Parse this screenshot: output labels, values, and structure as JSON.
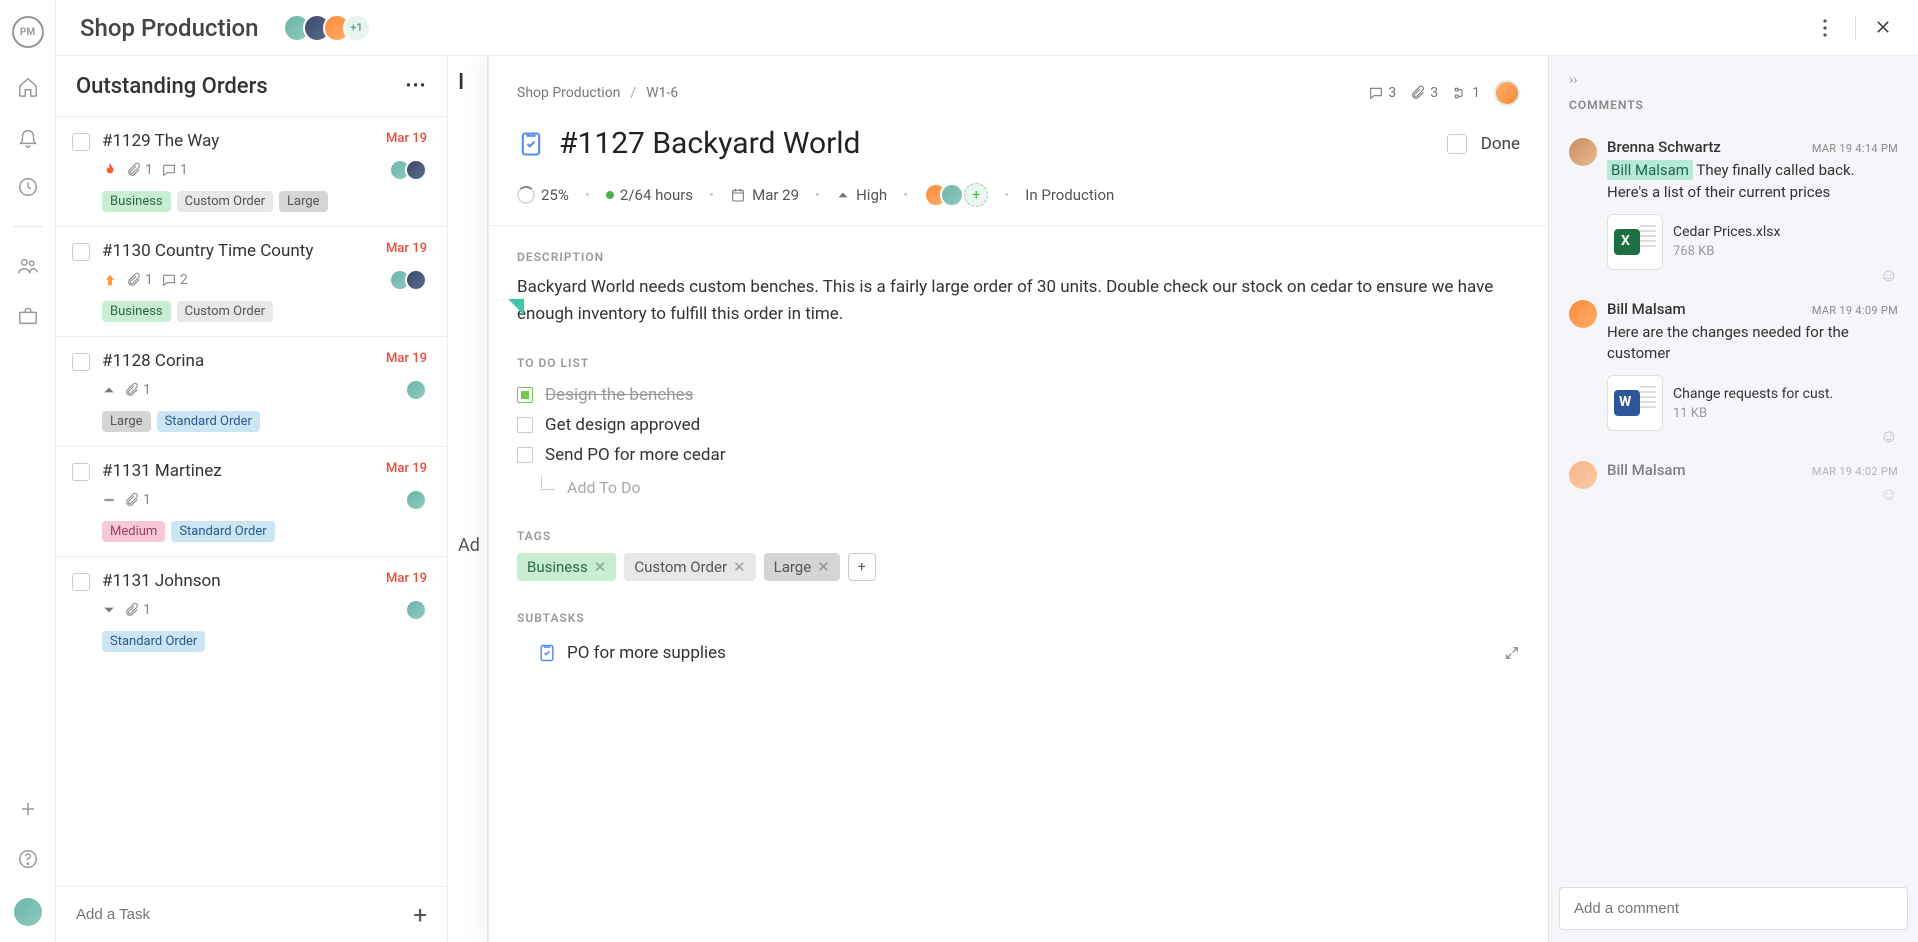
{
  "header": {
    "title": "Shop Production",
    "avatar_plus": "+1"
  },
  "column": {
    "title": "Outstanding Orders",
    "add_placeholder": "Add a Task"
  },
  "peek": {
    "title_frag": "I",
    "add_frag": "Ad"
  },
  "cards": [
    {
      "title": "#1129 The Way",
      "date": "Mar 19",
      "priority": "critical",
      "attach": "1",
      "comments": "1",
      "tags": [
        "Business",
        "Custom Order",
        "Large"
      ],
      "avatars": 2
    },
    {
      "title": "#1130 Country Time County",
      "date": "Mar 19",
      "priority": "high-orange",
      "attach": "1",
      "comments": "2",
      "tags": [
        "Business",
        "Custom Order"
      ],
      "avatars": 2
    },
    {
      "title": "#1128 Corina",
      "date": "Mar 19",
      "priority": "high",
      "attach": "1",
      "comments": null,
      "tags": [
        "Large",
        "Standard Order"
      ],
      "avatars": 1
    },
    {
      "title": "#1131 Martinez",
      "date": "Mar 19",
      "priority": "normal",
      "attach": "1",
      "comments": null,
      "tags": [
        "Medium",
        "Standard Order"
      ],
      "avatars": 1
    },
    {
      "title": "#1131 Johnson",
      "date": "Mar 19",
      "priority": "low",
      "attach": "1",
      "comments": null,
      "tags": [
        "Standard Order"
      ],
      "avatars": 1
    }
  ],
  "detail": {
    "crumb1": "Shop Production",
    "crumb2": "W1-6",
    "stat_comments": "3",
    "stat_attach": "3",
    "stat_sub": "1",
    "title": "#1127 Backyard World",
    "done_label": "Done",
    "progress": "25%",
    "hours": "2/64 hours",
    "due": "Mar 29",
    "priority": "High",
    "status": "In Production",
    "desc_label": "DESCRIPTION",
    "description": "Backyard World needs custom benches. This is a fairly large order of 30 units. Double check our stock on cedar to ensure we have enough inventory to fulfill this order in time.",
    "todo_label": "TO DO LIST",
    "todos": [
      {
        "text": "Design the benches",
        "done": true
      },
      {
        "text": "Get design approved",
        "done": false
      },
      {
        "text": "Send PO for more cedar",
        "done": false
      }
    ],
    "todo_add": "Add To Do",
    "tags_label": "TAGS",
    "tags": [
      {
        "label": "Business",
        "cls": "tag-business"
      },
      {
        "label": "Custom Order",
        "cls": "tag-custom"
      },
      {
        "label": "Large",
        "cls": "tag-large"
      }
    ],
    "subtasks_label": "SUBTASKS",
    "subtask1": "PO for more supplies"
  },
  "comments": {
    "title": "COMMENTS",
    "input_placeholder": "Add a comment",
    "items": [
      {
        "author": "Brenna Schwartz",
        "time": "MAR 19 4:14 PM",
        "mention": "Bill Malsam",
        "text": " They finally called back. Here's a list of their current prices",
        "att_name": "Cedar Prices.xlsx",
        "att_size": "768 KB",
        "att_kind": "xl"
      },
      {
        "author": "Bill Malsam",
        "time": "MAR 19 4:09 PM",
        "mention": null,
        "text": "Here are the changes needed for the customer",
        "att_name": "Change requests for cust.",
        "att_size": "11 KB",
        "att_kind": "doc"
      },
      {
        "author": "Bill Malsam",
        "time": "MAR 19 4:02 PM",
        "mention": null,
        "text": "",
        "att_name": null,
        "att_size": null,
        "att_kind": null
      }
    ]
  },
  "ui": {
    "logo": "PM"
  }
}
